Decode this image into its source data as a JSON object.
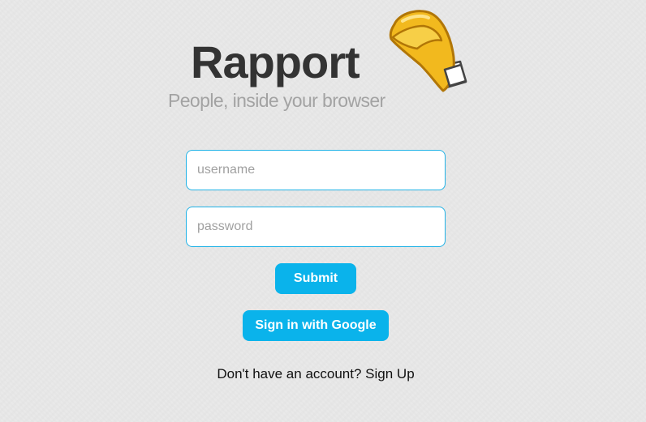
{
  "header": {
    "title": "Rapport",
    "subtitle": "People, inside your browser"
  },
  "logo": {
    "icon": "fortune-cookie-icon",
    "colors": {
      "cookie": "#f2b91e",
      "cookie_dark": "#b17607",
      "paper": "#ffffff"
    }
  },
  "login_form": {
    "username": {
      "value": "",
      "placeholder": "username"
    },
    "password": {
      "value": "",
      "placeholder": "password"
    },
    "submit_label": "Submit",
    "google_label": "Sign in with Google"
  },
  "signup": {
    "prompt": "Don't have an account?",
    "link_label": "Sign Up"
  },
  "colors": {
    "accent": "#0ab3eb",
    "background": "#e9e9e9",
    "title": "#333333",
    "subtitle": "#a3a3a3"
  }
}
